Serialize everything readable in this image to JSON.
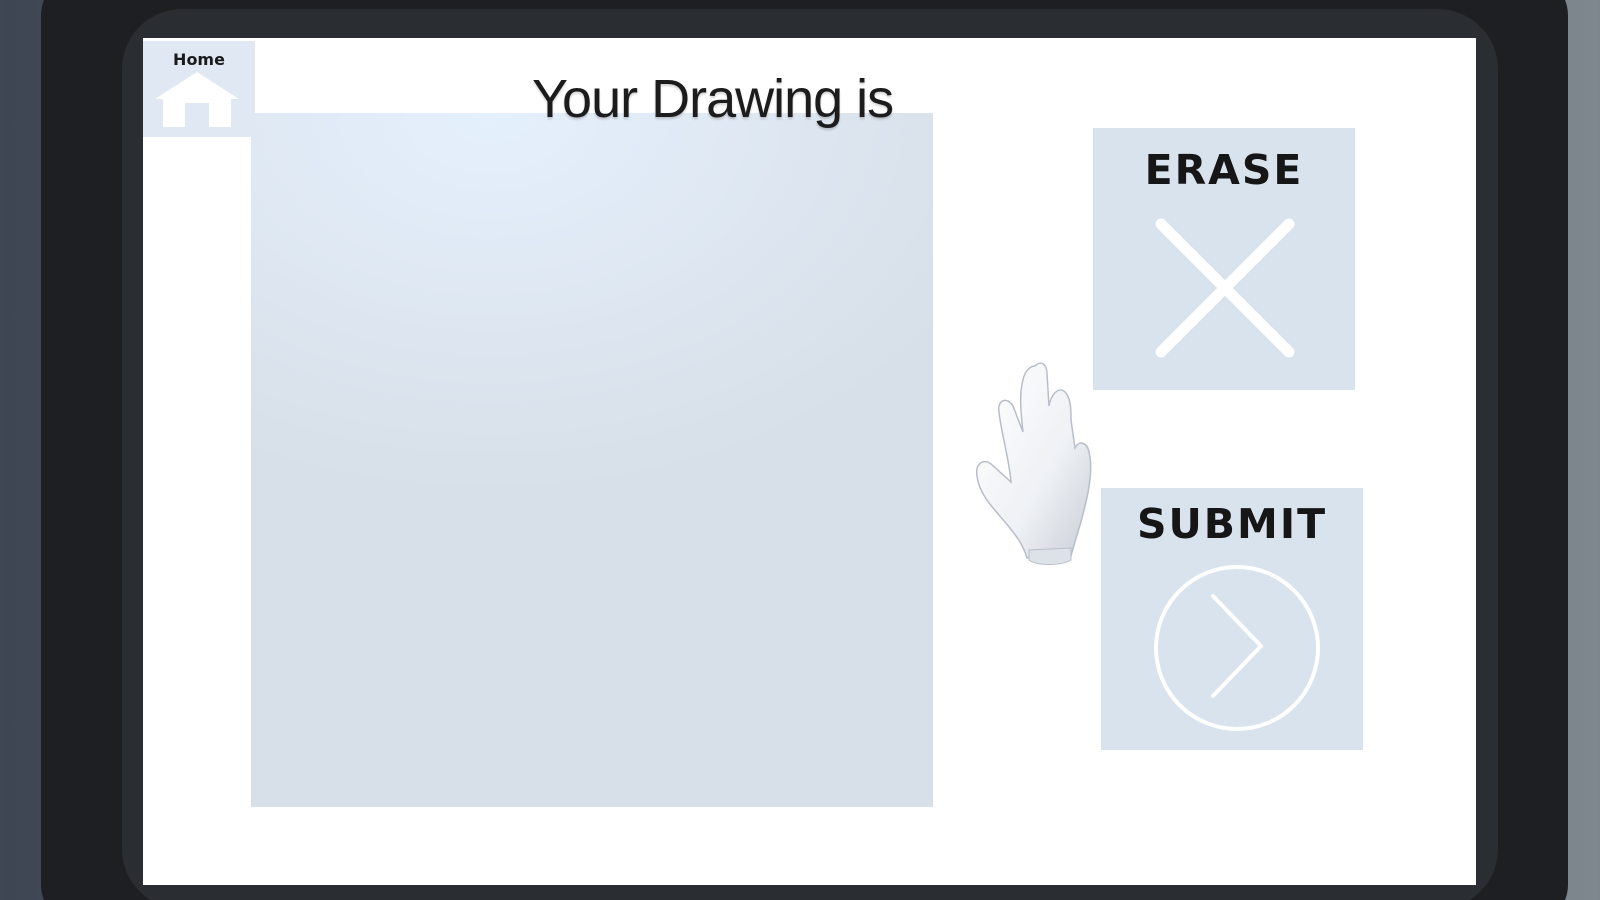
{
  "home": {
    "label": "Home",
    "icon": "home-icon"
  },
  "canvas": {
    "title": "Your Drawing is"
  },
  "actions": {
    "erase": {
      "label": "ERASE",
      "icon": "close-x-icon"
    },
    "submit": {
      "label": "SUBMIT",
      "icon": "chevron-right-circle-icon"
    }
  },
  "cursor": {
    "icon": "hand-pointer-icon"
  },
  "colors": {
    "screen_background": "#ffffff",
    "panel_background": "#d9e3ee",
    "icon_stroke": "#ffffff",
    "text": "#161616",
    "device_frame": "#1d1f22"
  }
}
